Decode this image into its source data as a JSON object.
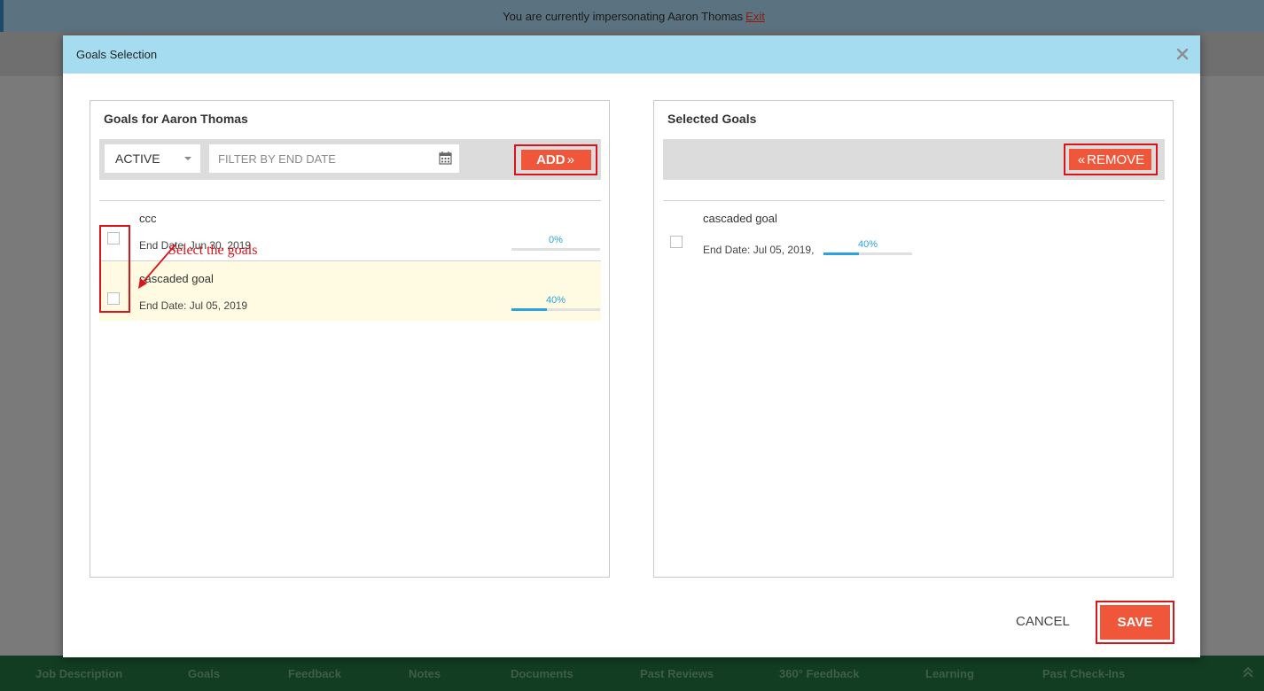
{
  "impersonation": {
    "message": "You are currently impersonating Aaron Thomas",
    "exit_label": "Exit"
  },
  "modal": {
    "title": "Goals Selection",
    "close_icon": "close-icon",
    "left_panel": {
      "title": "Goals for Aaron Thomas",
      "status_filter": {
        "selected": "ACTIVE"
      },
      "date_filter_placeholder": "FILTER BY END DATE",
      "add_label": "ADD",
      "annotation": "Select the goals",
      "goals": [
        {
          "name": "ccc",
          "end_date": "End Date: Jun 30, 2019",
          "progress_label": "0%",
          "progress": 0
        },
        {
          "name": "cascaded goal",
          "end_date": "End Date: Jul 05, 2019",
          "progress_label": "40%",
          "progress": 0.4
        }
      ]
    },
    "right_panel": {
      "title": "Selected Goals",
      "remove_label": "REMOVE",
      "goals": [
        {
          "name": "cascaded goal",
          "end_date": "End Date: Jul 05, 2019,",
          "progress_label": "40%",
          "progress": 0.4
        }
      ]
    },
    "cancel_label": "CANCEL",
    "save_label": "SAVE"
  },
  "bottom_nav": {
    "items": [
      "Job Description",
      "Goals",
      "Feedback",
      "Notes",
      "Documents",
      "Past Reviews",
      "360° Feedback",
      "Learning",
      "Past Check-Ins"
    ]
  },
  "colors": {
    "accent": "#f0573a",
    "header": "#a6dcf0",
    "progress": "#2ba3e0",
    "annotation": "#d9141b",
    "highlight_row": "#fefbe2"
  }
}
